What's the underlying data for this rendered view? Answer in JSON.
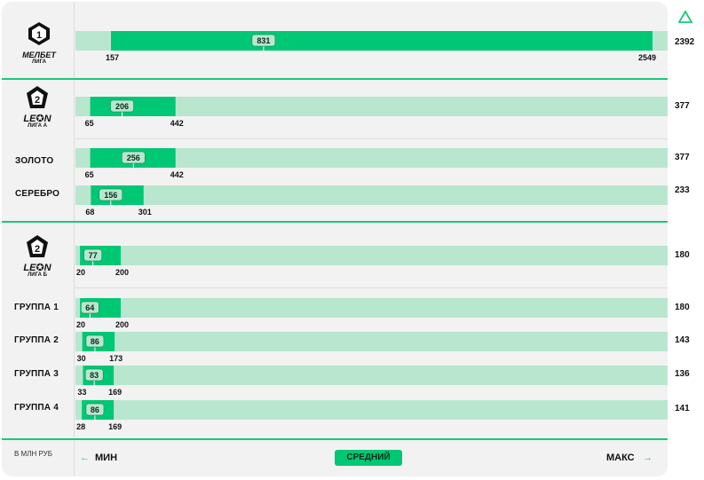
{
  "colors": {
    "track": "#b8e6cf",
    "range": "#00c774",
    "avg_pill": "#b9e6cf",
    "text": "#111111",
    "accent": "#19c97a"
  },
  "chart_data": {
    "type": "range-bar",
    "scale_max": 2549,
    "rows": [
      {
        "label": "МЕЛБЕТ ЛИГА",
        "min": 157,
        "avg": 831,
        "max": 2549,
        "max_label": 2392
      },
      {
        "label": "LEON ЛИГА А",
        "min": 65,
        "avg": 206,
        "max": 442,
        "max_label": 377
      },
      {
        "label": "ЗОЛОТО",
        "min": 65,
        "avg": 256,
        "max": 442,
        "max_label": 377
      },
      {
        "label": "СЕРЕБРО",
        "min": 68,
        "avg": 156,
        "max": 301,
        "max_label": 233
      },
      {
        "label": "LEON ЛИГА Б",
        "min": 20,
        "avg": 77,
        "max": 200,
        "max_label": 180
      },
      {
        "label": "ГРУППА 1",
        "min": 20,
        "avg": 64,
        "max": 200,
        "max_label": 180
      },
      {
        "label": "ГРУППА 2",
        "min": 30,
        "avg": 86,
        "max": 173,
        "max_label": 143
      },
      {
        "label": "ГРУППА 3",
        "min": 33,
        "avg": 83,
        "max": 169,
        "max_label": 136
      },
      {
        "label": "ГРУППА 4",
        "min": 28,
        "avg": 86,
        "max": 169,
        "max_label": 141
      }
    ]
  },
  "leagues": {
    "melbet": {
      "badge": "1",
      "brand": "МЕЛБЕТ",
      "sub": "ЛИГА"
    },
    "leon_a": {
      "badge": "2",
      "brand": "LE✪N",
      "sub": "ЛИГА А"
    },
    "leon_b": {
      "badge": "2",
      "brand": "LE✪N",
      "sub": "ЛИГА Б"
    }
  },
  "row_labels": {
    "zoloto": "ЗОЛОТО",
    "serebro": "СЕРЕБРО",
    "gruppa1": "ГРУППА 1",
    "gruppa2": "ГРУППА 2",
    "gruppa3": "ГРУППА 3",
    "gruppa4": "ГРУППА 4"
  },
  "max_values": [
    "2392",
    "377",
    "377",
    "233",
    "180",
    "180",
    "143",
    "136",
    "141"
  ],
  "footer": {
    "unit": "В МЛН РУБ",
    "min_label": "МИН",
    "avg_label": "СРЕДНИЙ",
    "max_label": "МАКС",
    "arrow_left": "←",
    "arrow_right": "→"
  }
}
